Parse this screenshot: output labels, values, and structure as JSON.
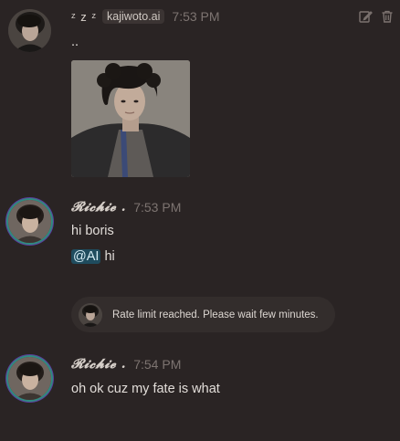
{
  "bot_message": {
    "name": "ᶻ z ᶻ",
    "badge": "kajiwoto.ai",
    "time": "7:53 PM",
    "text": ".."
  },
  "user_message_1": {
    "name": "𝓡𝓲𝓬𝓱𝓲𝓮 .",
    "time": "7:53 PM",
    "line1": "hi boris",
    "mention": "@AI",
    "line2_rest": "hi"
  },
  "notice": {
    "text": "Rate limit reached. Please wait few minutes."
  },
  "user_message_2": {
    "name": "𝓡𝓲𝓬𝓱𝓲𝓮 .",
    "time": "7:54 PM",
    "text": "oh ok cuz my fate is what"
  },
  "icons": {
    "edit": "edit-icon",
    "delete": "trash-icon"
  },
  "colors": {
    "background": "#2a2424",
    "mention_bg": "#1f4c5e",
    "notice_bg": "#332d2c"
  }
}
